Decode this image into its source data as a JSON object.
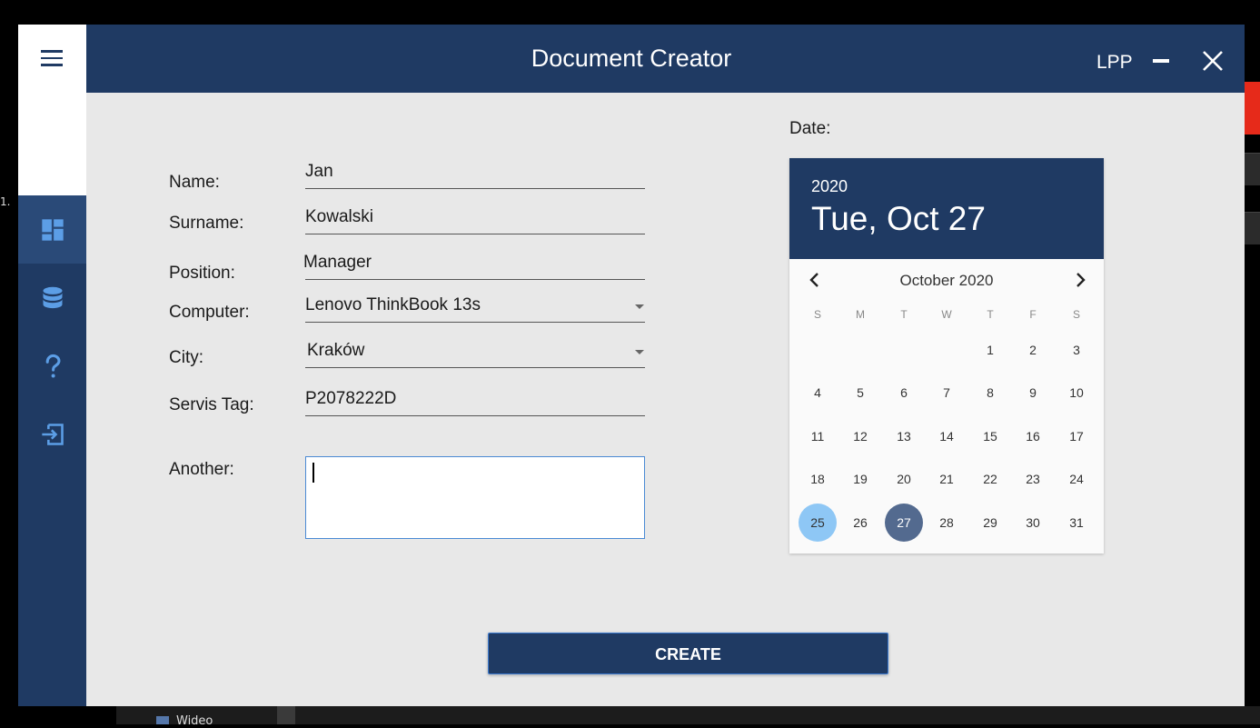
{
  "background": {
    "left_text": "1.",
    "taskbar_text": "Wideo"
  },
  "titlebar": {
    "title": "Document Creator",
    "user": "LPP"
  },
  "sidebar": {
    "items": [
      {
        "name": "dashboard",
        "icon": "dashboard-icon",
        "active": true
      },
      {
        "name": "database",
        "icon": "database-icon",
        "active": false
      },
      {
        "name": "help",
        "icon": "help-icon",
        "active": false
      },
      {
        "name": "logout",
        "icon": "logout-icon",
        "active": false
      }
    ]
  },
  "form": {
    "name_label": "Name:",
    "name_value": "Jan",
    "surname_label": "Surname:",
    "surname_value": "Kowalski",
    "position_label": "Position:",
    "position_value": "Manager",
    "computer_label": "Computer:",
    "computer_value": "Lenovo ThinkBook 13s",
    "city_label": "City:",
    "city_value": "Kraków",
    "servis_label": "Servis Tag:",
    "servis_value": "P2078222D",
    "another_label": "Another:",
    "another_value": ""
  },
  "calendar": {
    "date_label": "Date:",
    "year": "2020",
    "selected_display": "Tue, Oct 27",
    "month_label": "October 2020",
    "weekdays": [
      "S",
      "M",
      "T",
      "W",
      "T",
      "F",
      "S"
    ],
    "first_weekday_index": 4,
    "days_in_month": 31,
    "today_day": 25,
    "selected_day": 27,
    "accent": "#1f3a63",
    "today_color": "#8ec7f5",
    "selected_color": "#536a8f"
  },
  "actions": {
    "create_label": "CREATE"
  }
}
